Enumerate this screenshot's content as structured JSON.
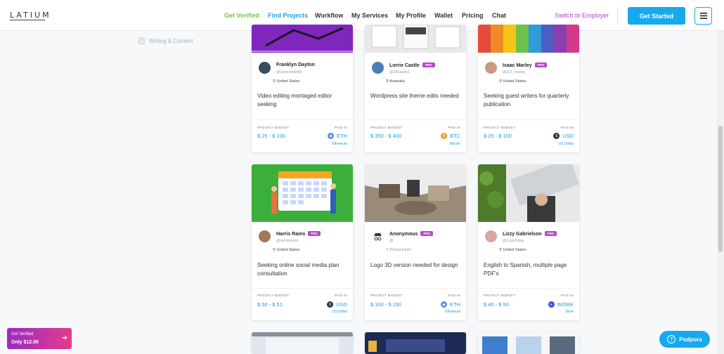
{
  "header": {
    "logo": "LATIUM",
    "nav": [
      {
        "label": "Get Verified",
        "style": "green"
      },
      {
        "label": "Find Projects",
        "style": "blue"
      },
      {
        "label": "Workflow",
        "style": ""
      },
      {
        "label": "My Services",
        "style": ""
      },
      {
        "label": "My Profile",
        "style": ""
      },
      {
        "label": "Wallet",
        "style": ""
      },
      {
        "label": "Pricing",
        "style": ""
      },
      {
        "label": "Chat",
        "style": ""
      }
    ],
    "switch_label": "Switch to Employer",
    "cta_label": "Get Started",
    "menu_icon": "hamburger-icon"
  },
  "sidebar": {
    "item_label": "Writing & Content",
    "item_icon": "writing-icon"
  },
  "colors": {
    "accent": "#16a9ee",
    "verified_green": "#7cc242",
    "pro_badge": "#b746c9",
    "employer_purple": "#b03fd8"
  },
  "cards": [
    {
      "name": "Franklyn Dayton",
      "pro": false,
      "handle": "@Undoubtedly",
      "location": "United States",
      "title": "Video editing montaged editor seeking",
      "budget_label": "PROJECT BUDGET",
      "paid_label": "PAID IN",
      "budget": "$ 25 - $ 100",
      "currency": "ETH",
      "currency_name": "Ethereum",
      "currency_icon": "ethereum-icon"
    },
    {
      "name": "Lorrie Castle",
      "pro": true,
      "pro_label": "PRO",
      "handle": "@28castle1",
      "location": "Australia",
      "title": "Wordpress site theme edits needed",
      "budget_label": "PROJECT BUDGET",
      "paid_label": "PAID IN",
      "budget": "$ 350 - $ 400",
      "currency": "BTC",
      "currency_name": "Bitcoin",
      "currency_icon": "bitcoin-icon"
    },
    {
      "name": "Isaac Marley",
      "pro": true,
      "pro_label": "PRO",
      "handle": "@i23_marley",
      "location": "United States",
      "title": "Seeking guest writers for quarterly publication",
      "budget_label": "PROJECT BUDGET",
      "paid_label": "PAID IN",
      "budget": "$ 25 - $ 100",
      "currency": "USD",
      "currency_name": "US Dollar",
      "currency_icon": "dollar-icon"
    },
    {
      "name": "Harris Rains",
      "pro": true,
      "pro_label": "PRO",
      "handle": "@rainspours",
      "location": "United States",
      "title": "Seeking online social media plan consultation",
      "budget_label": "PROJECT BUDGET",
      "paid_label": "PAID IN",
      "budget": "$ 50 - $ 51",
      "currency": "USD",
      "currency_name": "US Dollar",
      "currency_icon": "dollar-icon"
    },
    {
      "name": "Anonymous",
      "pro": true,
      "pro_label": "PRO",
      "handle": "@",
      "location": "Planet Earth",
      "title": "Logo 3D version needed for design",
      "budget_label": "PROJECT BUDGET",
      "paid_label": "PAID IN",
      "budget": "$ 100 - $ 150",
      "currency": "ETH",
      "currency_name": "Ethereum",
      "currency_icon": "ethereum-icon"
    },
    {
      "name": "Lizzy Gabrielson",
      "pro": true,
      "pro_label": "PRO",
      "handle": "@Lizzy2day",
      "location": "United States",
      "title": "English to Spanish, multiple page PDF's",
      "budget_label": "PROJECT BUDGET",
      "paid_label": "PAID IN",
      "budget": "$ 40 - $ 50",
      "currency": "WORK",
      "currency_name": "Work",
      "currency_icon": "work-token-icon"
    }
  ],
  "promo": {
    "line1": "Get Verified",
    "line2": "Only $12.00",
    "arrow_icon": "arrow-right-icon"
  },
  "help": {
    "label": "Podpora",
    "icon": "question-icon"
  }
}
